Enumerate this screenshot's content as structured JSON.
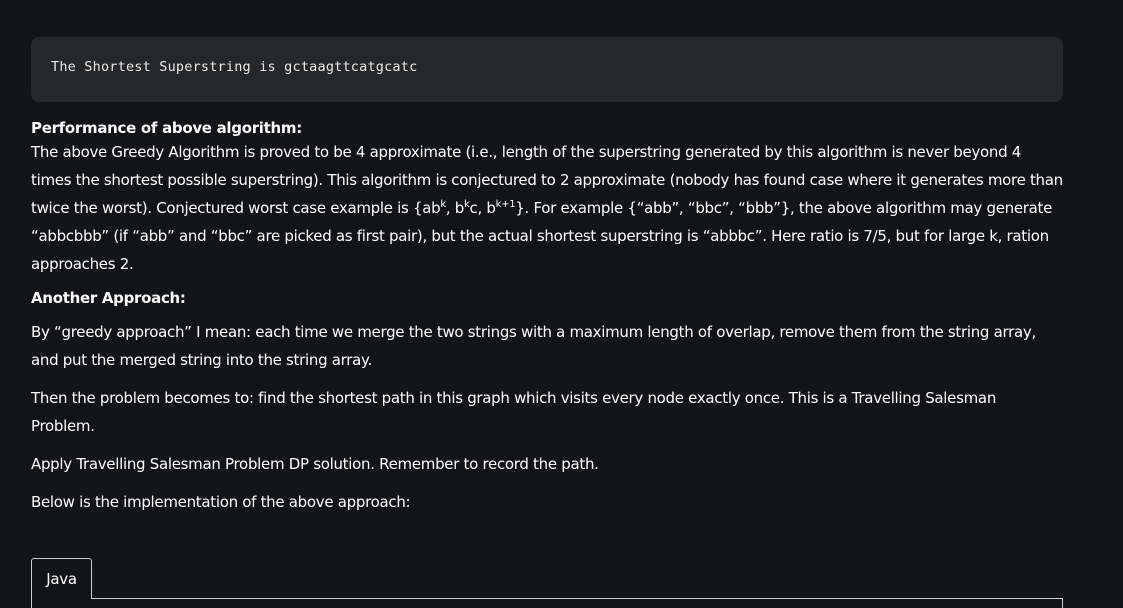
{
  "output": {
    "text": "The Shortest Superstring is gctaagttcatgcatc"
  },
  "performance": {
    "heading": "Performance of above algorithm:",
    "p1_a": "The above Greedy Algorithm is proved to be 4 approximate (i.e., length of the superstring generated by this algorithm is never beyond 4 times the shortest possible superstring). This algorithm is conjectured to 2 approximate (nobody has found case where it generates more than twice the worst). Conjectured worst case example is {ab",
    "sup_k1": "k",
    "p1_b": ", b",
    "sup_k2": "k",
    "p1_c": "c, b",
    "sup_k3": "k+1",
    "p1_d": "}. For example {“abb”, “bbc”, “bbb”}, the above algorithm may generate “abbcbbb” (if “abb” and “bbc” are picked as first pair), but the actual shortest superstring is “abbbc”. Here ratio is 7/5, but for large k, ration approaches 2."
  },
  "another": {
    "heading": "Another Approach:",
    "p1": "By “greedy approach” I mean: each time we merge the two strings with a maximum length of overlap, remove them from the string array, and put the merged string into the string array.",
    "p2": "Then the problem becomes to: find the shortest path in this graph which visits every node exactly once. This is a Travelling Salesman Problem.",
    "p3": "Apply Travelling Salesman Problem DP solution. Remember to record the path.",
    "p4": "Below is the implementation of the above approach:"
  },
  "tabs": {
    "java_label": "Java"
  },
  "colors": {
    "background": "#131417",
    "code_block": "#262729",
    "text": "#ffffff"
  }
}
